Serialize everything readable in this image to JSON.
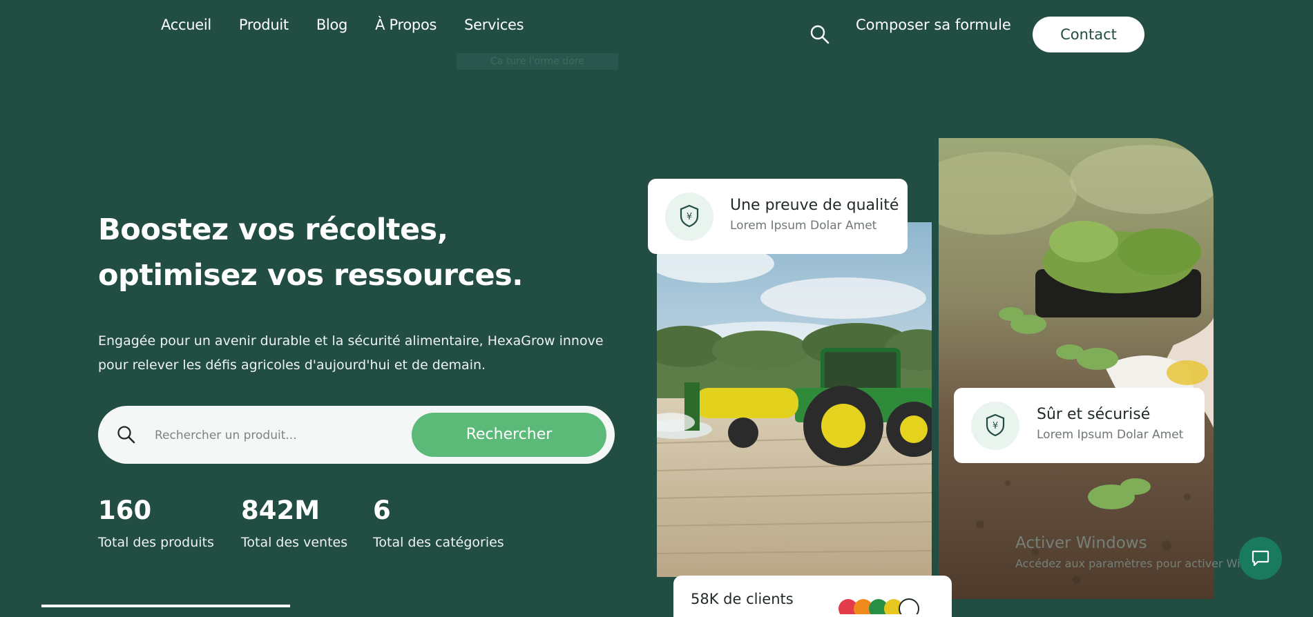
{
  "nav": {
    "items": [
      "Accueil",
      "Produit",
      "Blog",
      "À Propos",
      "Services"
    ],
    "tooltip": "Ca ture l'orme dore",
    "compose_label": "Composer sa formule",
    "contact_label": "Contact"
  },
  "hero": {
    "title": "Boostez vos récoltes, optimisez vos ressources.",
    "description": "Engagée pour un avenir durable et la sécurité alimentaire, HexaGrow innove pour relever les défis agricoles d'aujourd'hui et de demain."
  },
  "search": {
    "placeholder": "Rechercher un produit...",
    "button_label": "Rechercher"
  },
  "stats": [
    {
      "value": "160",
      "label": "Total des produits"
    },
    {
      "value": "842M",
      "label": "Total des ventes"
    },
    {
      "value": "6",
      "label": "Total des catégories"
    }
  ],
  "cards": {
    "quality": {
      "title": "Une preuve de qualité",
      "subtitle": "Lorem Ipsum Dolar Amet"
    },
    "secure": {
      "title": "Sûr et sécurisé",
      "subtitle": "Lorem Ipsum Dolar Amet"
    },
    "clients": {
      "title": "58K de clients"
    }
  },
  "watermark": {
    "line1": "Activer Windows",
    "line2": "Accédez aux paramètres pour activer Windows."
  },
  "colors": {
    "background": "#224d43",
    "accent": "#5cba78",
    "white": "#ffffff"
  },
  "icons": [
    "search-icon",
    "shield-yen-icon",
    "chat-icon"
  ]
}
